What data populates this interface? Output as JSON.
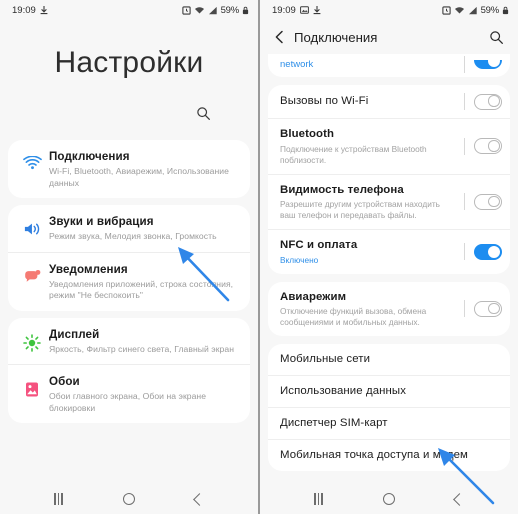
{
  "status_bar": {
    "time": "19:09",
    "battery_text": "59%",
    "icons": [
      "download-icon",
      "alarm-icon",
      "wifi-icon",
      "signal-icon",
      "lock-icon"
    ],
    "right_icons_extra": [
      "image-icon"
    ]
  },
  "left_screen": {
    "page_title": "Настройки",
    "search_icon": "search-icon",
    "groups": [
      {
        "items": [
          {
            "icon": "wifi-icon",
            "icon_color": "#2f8fe8",
            "title": "Подключения",
            "subtitle": "Wi-Fi, Bluetooth, Авиарежим, Использование данных"
          }
        ]
      },
      {
        "items": [
          {
            "icon": "volume-icon",
            "icon_color": "#2f7fe0",
            "title": "Звуки и вибрация",
            "subtitle": "Режим звука, Мелодия звонка, Громкость"
          },
          {
            "icon": "notification-icon",
            "icon_color": "#f57a73",
            "title": "Уведомления",
            "subtitle": "Уведомления приложений, строка состояния, режим \"Не беспокоить\""
          }
        ]
      },
      {
        "items": [
          {
            "icon": "brightness-icon",
            "icon_color": "#3fc43f",
            "title": "Дисплей",
            "subtitle": "Яркость, Фильтр синего света, Главный экран"
          },
          {
            "icon": "wallpaper-icon",
            "icon_color": "#f5527f",
            "title": "Обои",
            "subtitle": "Обои главного экрана, Обои на экране блокировки"
          }
        ]
      }
    ]
  },
  "right_screen": {
    "appbar": {
      "back_icon": "back-arrow-icon",
      "title": "Подключения",
      "search_icon": "search-icon"
    },
    "groups": [
      {
        "clipped_top": true,
        "items": [
          {
            "title": "",
            "link": "network",
            "toggle": "on",
            "partial": true
          }
        ]
      },
      {
        "items": [
          {
            "title": "Вызовы по Wi-Fi",
            "subtitle": "",
            "toggle": "off"
          },
          {
            "title": "Bluetooth",
            "subtitle": "Подключение к устройствам Bluetooth поблизости.",
            "toggle": "off",
            "bold": true
          },
          {
            "title": "Видимость телефона",
            "subtitle": "Разрешите другим устройствам находить ваш телефон и передавать файлы.",
            "toggle": "off",
            "bold": true
          },
          {
            "title": "NFC и оплата",
            "subtitle": "Включено",
            "subtitle_accent": true,
            "toggle": "on",
            "bold": true
          }
        ]
      },
      {
        "items": [
          {
            "title": "Авиарежим",
            "subtitle": "Отключение функций вызова, обмена сообщениями и мобильных данных.",
            "toggle": "off",
            "bold": true
          }
        ]
      },
      {
        "items": [
          {
            "title": "Мобильные сети",
            "subtitle": "",
            "toggle": "none"
          },
          {
            "title": "Использование данных",
            "subtitle": "",
            "toggle": "none"
          },
          {
            "title": "Диспетчер SIM-карт",
            "subtitle": "",
            "toggle": "none"
          },
          {
            "title": "Мобильная точка доступа и модем",
            "subtitle": "",
            "toggle": "none"
          }
        ]
      }
    ]
  },
  "nav_bar": {
    "recents": "recents-icon",
    "home": "home-icon",
    "back": "back-icon"
  },
  "annotations": {
    "arrow_color": "#2f86e8",
    "left_arrow_target": "Подключения",
    "right_arrow_target": "Мобильная точка доступа и модем"
  },
  "colors": {
    "accent": "#2f8fe8",
    "toggle_on": "#1d8df0",
    "screen_bg": "#f7f7f7",
    "card_bg": "#ffffff"
  }
}
